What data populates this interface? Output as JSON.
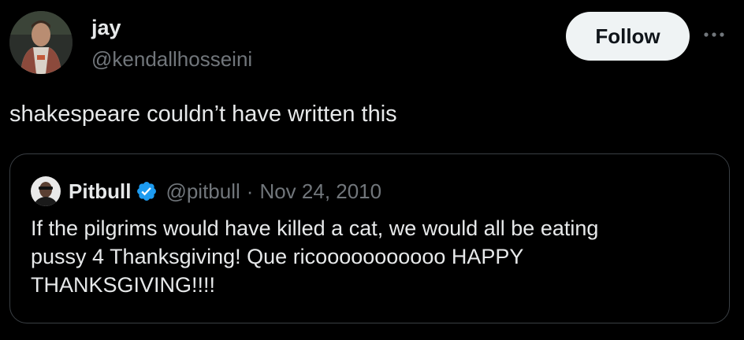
{
  "tweet": {
    "author": {
      "name": "jay",
      "handle": "@kendallhosseini",
      "avatar": "profile-photo"
    },
    "follow_label": "Follow",
    "more_icon": "more-horizontal-icon",
    "text": "shakespeare couldn’t have written this"
  },
  "quoted_tweet": {
    "author": {
      "name": "Pitbull",
      "handle": "@pitbull",
      "verified": true,
      "verified_icon": "verified-badge-icon",
      "avatar": "profile-photo"
    },
    "separator": "·",
    "date": "Nov 24, 2010",
    "text": "If the pilgrims would have killed a cat, we would all be eating\npussy 4 Thanksgiving!  Que ricooooooooooo HAPPY\nTHANKSGIVING!!!!"
  },
  "colors": {
    "background": "#000000",
    "primary_text": "#e7e9ea",
    "secondary_text": "#71767b",
    "follow_button_bg": "#eff3f4",
    "follow_button_text": "#0f1419",
    "verified_blue": "#1d9bf0",
    "card_border": "#3a3f44"
  }
}
